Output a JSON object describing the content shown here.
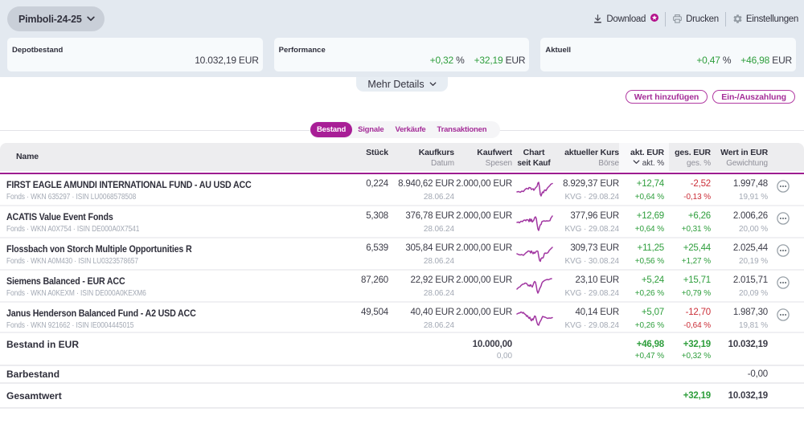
{
  "brand": {
    "magenta": "#a81e96",
    "green": "#2e9e3c",
    "red": "#cb2e38"
  },
  "header": {
    "portfolio_selector": "Pimboli-24-25",
    "actions": [
      {
        "label": "Download",
        "icon": "download-icon",
        "badge": "star-badge"
      },
      {
        "label": "Drucken",
        "icon": "printer-icon"
      },
      {
        "label": "Einstellungen",
        "icon": "gear-icon"
      }
    ],
    "cards": [
      {
        "label": "Depotbestand",
        "value": "10.032,19 EUR"
      },
      {
        "label": "Performance",
        "percent": "+0,32",
        "percent_suffix": "%",
        "amount": "+32,19",
        "amount_suffix": "EUR"
      },
      {
        "label": "Aktuell",
        "percent": "+0,47",
        "percent_suffix": "%",
        "amount": "+46,98",
        "amount_suffix": "EUR"
      }
    ],
    "more_details_label": "Mehr Details"
  },
  "toolbar": {
    "buttons": [
      "Wert hinzufügen",
      "Ein-/Auszahlung"
    ]
  },
  "tabs": [
    {
      "label": "Bestand",
      "active": true
    },
    {
      "label": "Signale",
      "active": false
    },
    {
      "label": "Verkäufe",
      "active": false
    },
    {
      "label": "Transaktionen",
      "active": false
    }
  ],
  "table": {
    "columns": [
      {
        "title": "Name",
        "sub": ""
      },
      {
        "title": "Stück",
        "sub": ""
      },
      {
        "title": "Kaufkurs",
        "sub": "Datum"
      },
      {
        "title": "Kaufwert",
        "sub": "Spesen"
      },
      {
        "title": "Chart",
        "sub": "seit Kauf"
      },
      {
        "title": "aktueller Kurs",
        "sub": "Börse"
      },
      {
        "title": "akt. EUR",
        "sub": "akt. %",
        "sorted": true
      },
      {
        "title": "ges. EUR",
        "sub": "ges. %"
      },
      {
        "title": "Wert in EUR",
        "sub": "Gewichtung"
      }
    ],
    "positions": [
      {
        "name": "FIRST EAGLE AMUNDI INTERNATIONAL FUND - AU USD ACC",
        "info": "Fonds · WKN 635297 · ISIN LU0068578508",
        "stueck": "0,224",
        "kaufkurs": "8.940,62 EUR",
        "kaufdatum": "28.06.24",
        "kaufwert": "2.000,00 EUR",
        "kurs": "8.929,37 EUR",
        "boerse": "KVG · 29.08.24",
        "akt_eur": "+12,74",
        "akt_pct": "+0,64 %",
        "akt_dir": "up",
        "ges_eur": "-2,52",
        "ges_pct": "-0,13 %",
        "ges_dir": "down",
        "wert": "1.997,48",
        "gewichtung": "19,91 %",
        "spark": [
          [
            1,
            16
          ],
          [
            3,
            15.5
          ],
          [
            5,
            16.5
          ],
          [
            7,
            15
          ],
          [
            9,
            15.5
          ],
          [
            11,
            13
          ],
          [
            13,
            11.5
          ],
          [
            15,
            12.5
          ],
          [
            16,
            10.5
          ],
          [
            18,
            11
          ],
          [
            19,
            13
          ],
          [
            21,
            12
          ],
          [
            22,
            14
          ],
          [
            24,
            11
          ],
          [
            26,
            9
          ],
          [
            27,
            5
          ],
          [
            28,
            4
          ],
          [
            29,
            10
          ],
          [
            30,
            19
          ],
          [
            31,
            21
          ],
          [
            32,
            18
          ],
          [
            33,
            16
          ],
          [
            34,
            17
          ],
          [
            35,
            14
          ],
          [
            36,
            13.5
          ],
          [
            37,
            14.5
          ],
          [
            39,
            11
          ],
          [
            40,
            10
          ],
          [
            41,
            9
          ],
          [
            42,
            8
          ],
          [
            43,
            6.5
          ],
          [
            45,
            5.5
          ]
        ]
      },
      {
        "name": "ACATIS Value Event Fonds",
        "info": "Fonds · WKN A0X754 · ISIN DE000A0X7541",
        "stueck": "5,308",
        "kaufkurs": "376,78 EUR",
        "kaufdatum": "28.06.24",
        "kaufwert": "2.000,00 EUR",
        "kurs": "377,96 EUR",
        "boerse": "KVG · 29.08.24",
        "akt_eur": "+12,69",
        "akt_pct": "+0,64 %",
        "akt_dir": "up",
        "ges_eur": "+6,26",
        "ges_pct": "+0,31 %",
        "ges_dir": "up",
        "wert": "2.006,26",
        "gewichtung": "20,00 %",
        "spark": [
          [
            1,
            14
          ],
          [
            3,
            13.5
          ],
          [
            4,
            14.5
          ],
          [
            6,
            12.5
          ],
          [
            8,
            13
          ],
          [
            9,
            11.5
          ],
          [
            11,
            11
          ],
          [
            12,
            12
          ],
          [
            13,
            10.5
          ],
          [
            15,
            11
          ],
          [
            16,
            13
          ],
          [
            17,
            9.5
          ],
          [
            18,
            12.5
          ],
          [
            19,
            10
          ],
          [
            20,
            13.5
          ],
          [
            22,
            11
          ],
          [
            23,
            8
          ],
          [
            24,
            7
          ],
          [
            25,
            9
          ],
          [
            26,
            16
          ],
          [
            27,
            22
          ],
          [
            28,
            24
          ],
          [
            29,
            20
          ],
          [
            30,
            17
          ],
          [
            31,
            16.5
          ],
          [
            32,
            13
          ],
          [
            33,
            12.5
          ],
          [
            35,
            12
          ],
          [
            36,
            12.5
          ],
          [
            38,
            12
          ],
          [
            40,
            12.2
          ],
          [
            42,
            11.8
          ],
          [
            43,
            9
          ],
          [
            45,
            6
          ]
        ]
      },
      {
        "name": "Flossbach von Storch Multiple Opportunities R",
        "info": "Fonds · WKN A0M430 · ISIN LU0323578657",
        "stueck": "6,539",
        "kaufkurs": "305,84 EUR",
        "kaufdatum": "28.06.24",
        "kaufwert": "2.000,00 EUR",
        "kurs": "309,73 EUR",
        "boerse": "KVG · 30.08.24",
        "akt_eur": "+11,25",
        "akt_pct": "+0,56 %",
        "akt_dir": "up",
        "ges_eur": "+25,44",
        "ges_pct": "+1,27 %",
        "ges_dir": "up",
        "wert": "2.025,44",
        "gewichtung": "20,19 %",
        "spark": [
          [
            1,
            13
          ],
          [
            3,
            14
          ],
          [
            5,
            14.5
          ],
          [
            7,
            14
          ],
          [
            9,
            15
          ],
          [
            11,
            13
          ],
          [
            12,
            12
          ],
          [
            14,
            10.5
          ],
          [
            15,
            9.5
          ],
          [
            17,
            10
          ],
          [
            18,
            12
          ],
          [
            19,
            9.5
          ],
          [
            20,
            11.5
          ],
          [
            21,
            13
          ],
          [
            22,
            11
          ],
          [
            23,
            12.5
          ],
          [
            25,
            10
          ],
          [
            26,
            9.5
          ],
          [
            27,
            10
          ],
          [
            28,
            16
          ],
          [
            29,
            21
          ],
          [
            30,
            22.5
          ],
          [
            31,
            19
          ],
          [
            32,
            18
          ],
          [
            33,
            18.5
          ],
          [
            34,
            17
          ],
          [
            35,
            13
          ],
          [
            36,
            12
          ],
          [
            37,
            12.5
          ],
          [
            39,
            12
          ],
          [
            40,
            11
          ],
          [
            41,
            9
          ],
          [
            43,
            7
          ],
          [
            45,
            5
          ]
        ]
      },
      {
        "name": "Siemens Balanced - EUR ACC",
        "info": "Fonds · WKN A0KEXM · ISIN DE000A0KEXM6",
        "stueck": "87,260",
        "kaufkurs": "22,92 EUR",
        "kaufdatum": "28.06.24",
        "kaufwert": "2.000,00 EUR",
        "kurs": "23,10 EUR",
        "boerse": "KVG · 29.08.24",
        "akt_eur": "+5,24",
        "akt_pct": "+0,26 %",
        "akt_dir": "up",
        "ges_eur": "+15,71",
        "ges_pct": "+0,79 %",
        "ges_dir": "up",
        "wert": "2.015,71",
        "gewichtung": "20,09 %",
        "spark": [
          [
            1,
            17
          ],
          [
            3,
            15
          ],
          [
            5,
            14
          ],
          [
            6,
            12.5
          ],
          [
            8,
            11
          ],
          [
            10,
            10.5
          ],
          [
            11,
            9.5
          ],
          [
            13,
            10
          ],
          [
            14,
            11.5
          ],
          [
            15,
            13
          ],
          [
            16,
            12
          ],
          [
            17,
            13.5
          ],
          [
            18,
            11.5
          ],
          [
            19,
            13
          ],
          [
            20,
            14.5
          ],
          [
            21,
            12
          ],
          [
            22,
            9
          ],
          [
            23,
            7.5
          ],
          [
            24,
            8.5
          ],
          [
            25,
            13
          ],
          [
            26,
            19
          ],
          [
            27,
            22
          ],
          [
            28,
            20
          ],
          [
            29,
            17
          ],
          [
            30,
            15
          ],
          [
            31,
            13
          ],
          [
            32,
            9.5
          ],
          [
            33,
            8
          ],
          [
            35,
            6.5
          ],
          [
            36,
            6
          ],
          [
            37,
            5.5
          ],
          [
            39,
            5
          ],
          [
            40,
            5.5
          ],
          [
            42,
            4.5
          ],
          [
            44,
            4
          ]
        ]
      },
      {
        "name": "Janus Henderson Balanced Fund - A2 USD ACC",
        "info": "Fonds · WKN 921662 · ISIN IE0004445015",
        "stueck": "49,504",
        "kaufkurs": "40,40 EUR",
        "kaufdatum": "28.06.24",
        "kaufwert": "2.000,00 EUR",
        "kurs": "40,14 EUR",
        "boerse": "KVG · 29.08.24",
        "akt_eur": "+5,07",
        "akt_pct": "+0,26 %",
        "akt_dir": "up",
        "ges_eur": "-12,70",
        "ges_pct": "-0,64 %",
        "ges_dir": "down",
        "wert": "1.987,30",
        "gewichtung": "19,81 %",
        "spark": [
          [
            1,
            8
          ],
          [
            3,
            7
          ],
          [
            5,
            6.5
          ],
          [
            6,
            5.5
          ],
          [
            7,
            6
          ],
          [
            8,
            7
          ],
          [
            9,
            6
          ],
          [
            10,
            7.5
          ],
          [
            12,
            9
          ],
          [
            13,
            11
          ],
          [
            14,
            10
          ],
          [
            15,
            12
          ],
          [
            16,
            13.5
          ],
          [
            17,
            12
          ],
          [
            18,
            15
          ],
          [
            19,
            16.5
          ],
          [
            20,
            14
          ],
          [
            21,
            15.5
          ],
          [
            22,
            13
          ],
          [
            23,
            10.5
          ],
          [
            24,
            11
          ],
          [
            25,
            15
          ],
          [
            26,
            19
          ],
          [
            27,
            21.5
          ],
          [
            28,
            22
          ],
          [
            29,
            19
          ],
          [
            30,
            17
          ],
          [
            31,
            15.5
          ],
          [
            32,
            13
          ],
          [
            33,
            11
          ],
          [
            34,
            11.5
          ],
          [
            36,
            12
          ],
          [
            37,
            12.5
          ],
          [
            38,
            13
          ],
          [
            39,
            13.5
          ],
          [
            41,
            13
          ],
          [
            43,
            13.2
          ],
          [
            45,
            12.5
          ]
        ]
      }
    ],
    "summary": {
      "bestand": {
        "label": "Bestand in EUR",
        "kaufwert": "10.000,00",
        "spesen": "0,00",
        "akt_eur": "+46,98",
        "akt_pct": "+0,47 %",
        "akt_dir": "up",
        "ges_eur": "+32,19",
        "ges_pct": "+0,32 %",
        "ges_dir": "up",
        "wert": "10.032,19"
      },
      "barbestand": {
        "label": "Barbestand",
        "wert": "-0,00"
      },
      "gesamtwert": {
        "label": "Gesamtwert",
        "ges_eur": "+32,19",
        "ges_dir": "up",
        "wert": "10.032,19"
      }
    }
  }
}
